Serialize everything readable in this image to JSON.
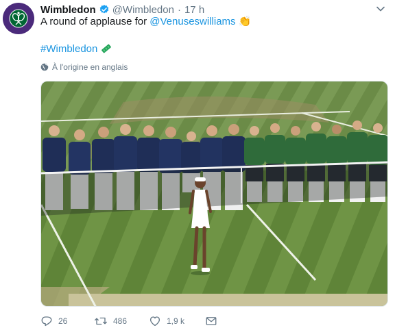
{
  "tweet": {
    "author_name": "Wimbledon",
    "handle": "@Wimbledon",
    "separator": "·",
    "time": "17 h",
    "text_prefix": "A round of applause for ",
    "mention": "@Venuseswilliams",
    "emoji": "👏",
    "hashtag": "#Wimbledon",
    "translate_label": "À l'origine en anglais",
    "avatar_text_top": "THE CHAMPIONSHIPS",
    "avatar_text_bottom": "WIMBLEDON"
  },
  "actions": {
    "reply_count": "26",
    "retweet_count": "486",
    "like_count": "1,9 k"
  },
  "colors": {
    "link": "#1b95e0",
    "brand_purple": "#4b2a7b",
    "brand_green": "#006633",
    "meta_gray": "#657786"
  },
  "icons": [
    "verified-icon",
    "chevron-down-icon",
    "globe-icon",
    "reply-icon",
    "retweet-icon",
    "like-icon",
    "message-icon"
  ]
}
